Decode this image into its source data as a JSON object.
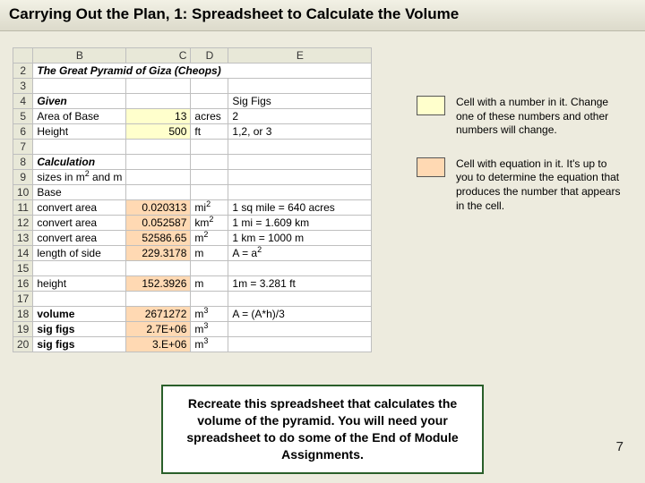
{
  "title": "Carrying Out the Plan, 1: Spreadsheet to Calculate the Volume",
  "cols": {
    "b": "B",
    "c": "C",
    "d": "D",
    "e": "E"
  },
  "rows": {
    "r2": {
      "n": "2",
      "b": "The Great Pyramid of Giza (Cheops)"
    },
    "r3": {
      "n": "3"
    },
    "r4": {
      "n": "4",
      "b": "Given",
      "e": "Sig Figs"
    },
    "r5": {
      "n": "5",
      "b": "Area of Base",
      "c": "13",
      "d": "acres",
      "e": "2"
    },
    "r6": {
      "n": "6",
      "b": "Height",
      "c": "500",
      "d": "ft",
      "e": "1,2, or 3"
    },
    "r7": {
      "n": "7"
    },
    "r8": {
      "n": "8",
      "b": "Calculation"
    },
    "r9": {
      "n": "9",
      "b_html": "sizes in m<sup>2</sup> and m"
    },
    "r10": {
      "n": "10",
      "b": "Base"
    },
    "r11": {
      "n": "11",
      "b": "convert area",
      "c": "0.020313",
      "d_html": "mi<sup>2</sup>",
      "e": "1 sq mile = 640 acres"
    },
    "r12": {
      "n": "12",
      "b": "convert area",
      "c": "0.052587",
      "d_html": "km<sup>2</sup>",
      "e": "1 mi = 1.609 km"
    },
    "r13": {
      "n": "13",
      "b": "convert area",
      "c": "52586.65",
      "d_html": "m<sup>2</sup>",
      "e": "1 km = 1000 m"
    },
    "r14": {
      "n": "14",
      "b": "length of side",
      "c": "229.3178",
      "d": "m",
      "e_html": "A = a<sup>2</sup>"
    },
    "r15": {
      "n": "15"
    },
    "r16": {
      "n": "16",
      "b": "height",
      "c": "152.3926",
      "d": "m",
      "e": "1m = 3.281 ft"
    },
    "r17": {
      "n": "17"
    },
    "r18": {
      "n": "18",
      "b": "volume",
      "c": "2671272",
      "d_html": "m<sup>3</sup>",
      "e": "A = (A*h)/3"
    },
    "r19": {
      "n": "19",
      "b": "sig figs",
      "c": "2.7E+06",
      "d_html": "m<sup>3</sup>"
    },
    "r20": {
      "n": "20",
      "b": "sig figs",
      "c": "3.E+06",
      "d_html": "m<sup>3</sup>"
    }
  },
  "legend": {
    "input": "Cell with a number in it. Change one of these numbers and other numbers will change.",
    "formula": "Cell with equation in it. It's up to you  to determine the equation that produces the number that appears in the cell."
  },
  "callout": "Recreate this spreadsheet that calculates the volume of the pyramid. You will need your spreadsheet to do some of the End of Module Assignments.",
  "pagenum": "7"
}
